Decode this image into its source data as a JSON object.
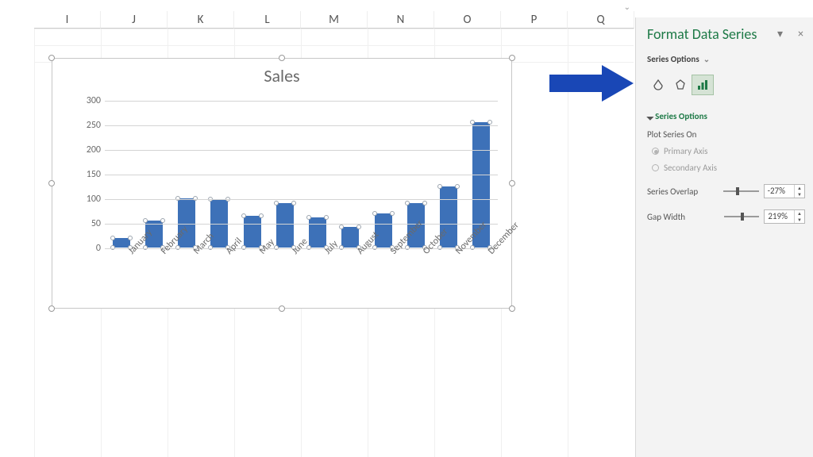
{
  "columns": [
    "I",
    "J",
    "K",
    "L",
    "M",
    "N",
    "O",
    "P",
    "Q"
  ],
  "chart_data": {
    "type": "bar",
    "title": "Sales",
    "xlabel": "",
    "ylabel": "",
    "ylim": [
      0,
      300
    ],
    "yticks": [
      0,
      50,
      100,
      150,
      200,
      250,
      300
    ],
    "categories": [
      "January",
      "February",
      "March",
      "April",
      "May",
      "June",
      "July",
      "August",
      "September",
      "October",
      "November",
      "December"
    ],
    "values": [
      20,
      55,
      100,
      98,
      64,
      90,
      62,
      42,
      70,
      90,
      125,
      255
    ],
    "series_selected": true,
    "bar_color": "#3d71b8"
  },
  "side_pane": {
    "title": "Format Data Series",
    "dropdown_label": "Series Options",
    "tabs": {
      "fill": "fill-icon",
      "effects": "effects-icon",
      "series": "series-icon"
    },
    "section": "Series Options",
    "plot_on_label": "Plot Series On",
    "axis_primary": "Primary Axis",
    "axis_secondary": "Secondary Axis",
    "axis_selected": "primary",
    "overlap_label": "Series Overlap",
    "overlap_value": "-27%",
    "gap_label": "Gap Width",
    "gap_value": "219%"
  }
}
